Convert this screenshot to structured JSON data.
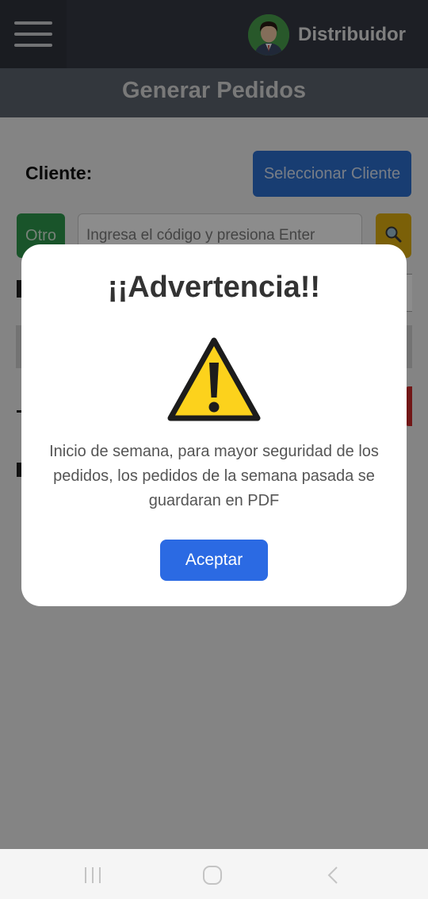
{
  "header": {
    "user_name": "Distribuidor",
    "avatar": "user-avatar"
  },
  "titlebar": {
    "title": "Generar Pedidos"
  },
  "form": {
    "cliente_label": "Cliente:",
    "select_client_label": "Seleccionar Cliente",
    "otro_label": "Otro",
    "code_placeholder": "Ingresa el código y presiona Enter",
    "search_icon": "magnifier-icon"
  },
  "modal": {
    "title": "¡¡Advertencia!!",
    "icon": "warning-icon",
    "message": "Inicio de semana, para mayor seguridad de los pedidos, los pedidos de la semana pasada se guardaran en PDF",
    "accept_label": "Aceptar"
  },
  "system_nav": {
    "recents": "recents-icon",
    "home": "home-icon",
    "back": "back-icon"
  },
  "colors": {
    "accent": "#2b6ae3",
    "warning": "#fcd21c",
    "topbar": "#353a44",
    "otro": "#2e9a4e",
    "search": "#e0b00f"
  }
}
